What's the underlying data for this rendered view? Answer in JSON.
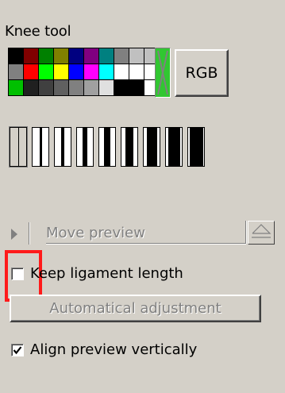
{
  "panel": {
    "title": "Knee tool"
  },
  "palette": {
    "colors": [
      "#000000",
      "#800000",
      "#008000",
      "#808000",
      "#000080",
      "#800080",
      "#008080",
      "#808080",
      "#c0c0c0",
      "#c0c0c0",
      "#808080",
      "#ff0000",
      "#00ff00",
      "#ffff00",
      "#0000ff",
      "#ff00ff",
      "#00ffff",
      "#ffffff",
      "#ffffff",
      "#ffffff",
      "#00c000",
      "#202020",
      "#404040",
      "#606060",
      "#808080",
      "#a0a0a0",
      "#e0e0e0",
      "#000000",
      "#000000",
      "#ffffff"
    ],
    "foreground_background_icon": "fg-bg-color-icon"
  },
  "buttons": {
    "rgb_label": "RGB",
    "auto_adjust_label": "Automatical adjustment"
  },
  "brushes": [
    {
      "name": "brush-1",
      "weight": 0.0
    },
    {
      "name": "brush-2",
      "weight": 0.1
    },
    {
      "name": "brush-3",
      "weight": 0.15
    },
    {
      "name": "brush-4",
      "weight": 0.2
    },
    {
      "name": "brush-5",
      "weight": 0.28
    },
    {
      "name": "brush-6",
      "weight": 0.36
    },
    {
      "name": "brush-7",
      "weight": 0.45
    },
    {
      "name": "brush-8",
      "weight": 0.55
    },
    {
      "name": "brush-9",
      "weight": 0.62
    }
  ],
  "move_preview": {
    "label": "Move preview",
    "expand_icon": "triangle-right-icon",
    "collapse_icon": "triangle-up-icon"
  },
  "options": {
    "keep_ligament_label": "Keep ligament length",
    "keep_ligament_checked": false,
    "align_preview_label": "Align preview vertically",
    "align_preview_checked": true
  },
  "colors": {
    "highlight": "#ff1a1a",
    "face": "#d4d0c8",
    "disabled_text": "#808080"
  }
}
